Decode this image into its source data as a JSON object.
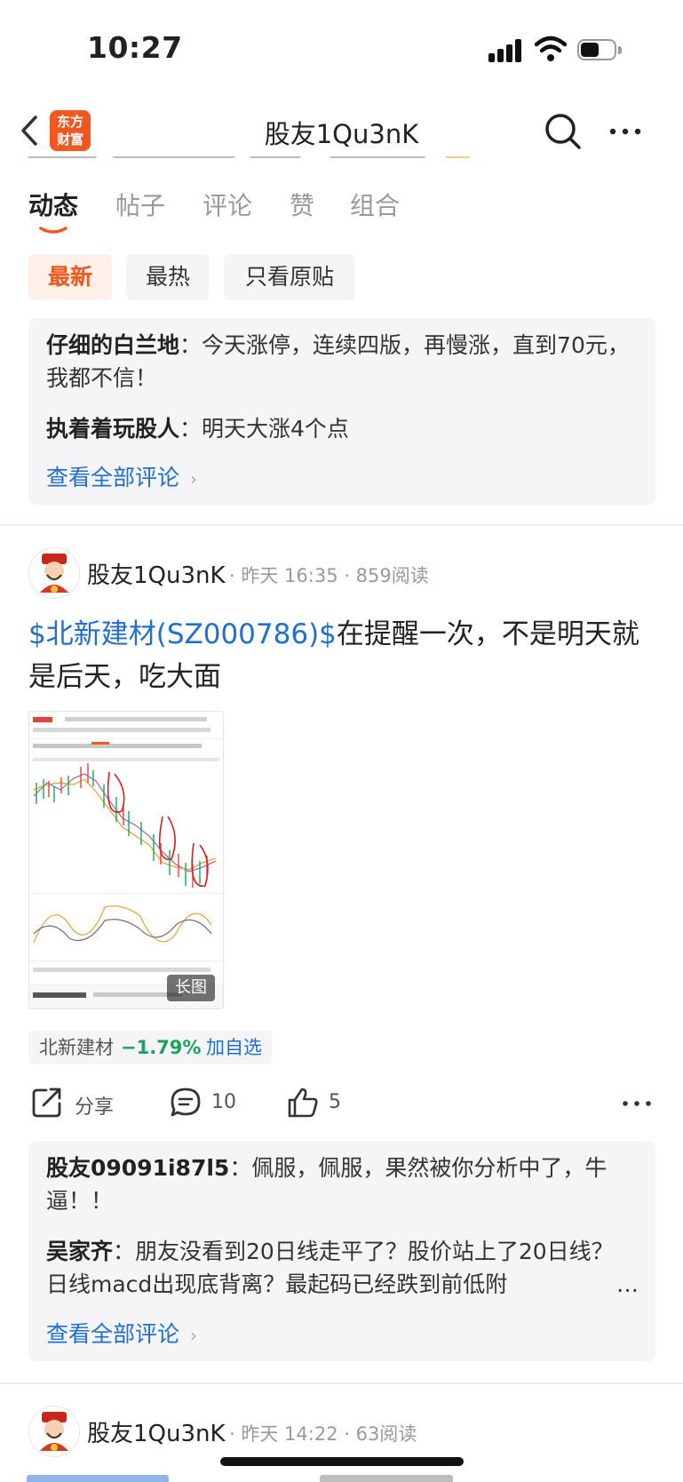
{
  "status_bar": {
    "time": "10:27"
  },
  "nav": {
    "title": "股友1Qu3nK",
    "logo_line1": "东方",
    "logo_line2": "财富"
  },
  "tabs": [
    {
      "label": "动态",
      "active": true
    },
    {
      "label": "帖子",
      "active": false
    },
    {
      "label": "评论",
      "active": false
    },
    {
      "label": "赞",
      "active": false
    },
    {
      "label": "组合",
      "active": false
    }
  ],
  "filters": [
    {
      "label": "最新",
      "active": true
    },
    {
      "label": "最热",
      "active": false
    },
    {
      "label": "只看原贴",
      "active": false
    }
  ],
  "top_comments": {
    "items": [
      {
        "user": "仔细的白兰地",
        "sep": "：",
        "text": "今天涨停，连续四版，再慢涨，直到70元，我都不信！"
      },
      {
        "user": "执着着玩股人",
        "sep": "：",
        "text": "明天大涨4个点"
      }
    ],
    "view_all": "查看全部评论"
  },
  "post": {
    "author": "股友1Qu3nK",
    "time": "昨天 16:35",
    "reads": "859阅读",
    "dot": "·",
    "stock_link": "$北新建材(SZ000786)$",
    "text": "在提醒一次，不是明天就是后天，吃大面",
    "image_badge": "长图",
    "stock_tag": {
      "name": "北新建材",
      "change": "−1.79%",
      "add": "加自选"
    },
    "actions": {
      "share": "分享",
      "comments": "10",
      "likes": "5"
    },
    "comments": [
      {
        "user": "股友09091i87l5",
        "sep": "：",
        "text": "佩服，佩服，果然被你分析中了，牛逼！！"
      },
      {
        "user": "吴家齐",
        "sep": "：",
        "text": "朋友没看到20日线走平了？股价站上了20日线？日线macd出现底背离？最起码已经跌到前低附"
      }
    ],
    "ellipsis": "…",
    "view_all": "查看全部评论"
  },
  "next_post": {
    "author": "股友1Qu3nK",
    "time": "昨天 14:22",
    "reads": "63阅读",
    "dot": "·"
  },
  "colors": {
    "brand": "#f1571f",
    "link": "#1f6fd0",
    "down": "#1aa260"
  }
}
